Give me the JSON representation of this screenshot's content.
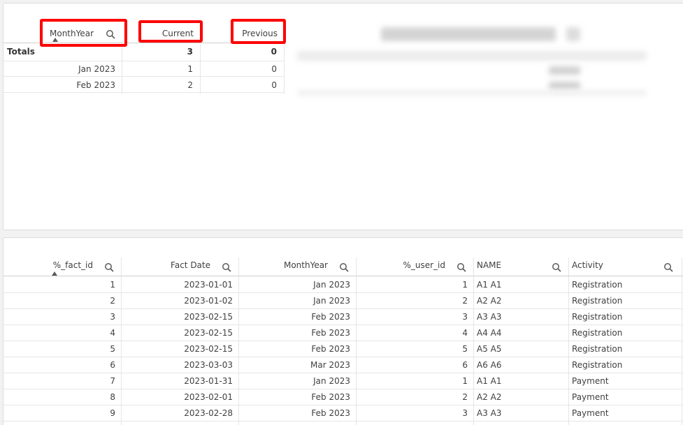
{
  "top_table": {
    "headers": {
      "monthyear": "MonthYear",
      "current": "Current",
      "previous": "Previous"
    },
    "totals": {
      "label": "Totals",
      "current": "3",
      "previous": "0"
    },
    "rows": [
      {
        "monthyear": "Jan 2023",
        "current": "1",
        "previous": "0"
      },
      {
        "monthyear": "Feb 2023",
        "current": "2",
        "previous": "0"
      }
    ]
  },
  "bottom_table": {
    "headers": {
      "fact_id": "%_fact_id",
      "fact_date": "Fact Date",
      "monthyear": "MonthYear",
      "user_id": "%_user_id",
      "name": "NAME",
      "activity": "Activity"
    },
    "rows": [
      {
        "fact_id": "1",
        "fact_date": "2023-01-01",
        "monthyear": "Jan 2023",
        "user_id": "1",
        "name": "A1 A1",
        "activity": "Registration"
      },
      {
        "fact_id": "2",
        "fact_date": "2023-01-02",
        "monthyear": "Jan 2023",
        "user_id": "2",
        "name": "A2 A2",
        "activity": "Registration"
      },
      {
        "fact_id": "3",
        "fact_date": "2023-02-15",
        "monthyear": "Feb 2023",
        "user_id": "3",
        "name": "A3 A3",
        "activity": "Registration"
      },
      {
        "fact_id": "4",
        "fact_date": "2023-02-15",
        "monthyear": "Feb 2023",
        "user_id": "4",
        "name": "A4 A4",
        "activity": "Registration"
      },
      {
        "fact_id": "5",
        "fact_date": "2023-02-15",
        "monthyear": "Feb 2023",
        "user_id": "5",
        "name": "A5 A5",
        "activity": "Registration"
      },
      {
        "fact_id": "6",
        "fact_date": "2023-03-03",
        "monthyear": "Mar 2023",
        "user_id": "6",
        "name": "A6 A6",
        "activity": "Registration"
      },
      {
        "fact_id": "7",
        "fact_date": "2023-01-31",
        "monthyear": "Jan 2023",
        "user_id": "1",
        "name": "A1 A1",
        "activity": "Payment"
      },
      {
        "fact_id": "8",
        "fact_date": "2023-02-01",
        "monthyear": "Feb 2023",
        "user_id": "2",
        "name": "A2 A2",
        "activity": "Payment"
      },
      {
        "fact_id": "9",
        "fact_date": "2023-02-28",
        "monthyear": "Feb 2023",
        "user_id": "3",
        "name": "A3 A3",
        "activity": "Payment"
      }
    ]
  },
  "colors": {
    "highlight": "#ff0000",
    "grid": "#e6e6e6",
    "text": "#404040"
  }
}
